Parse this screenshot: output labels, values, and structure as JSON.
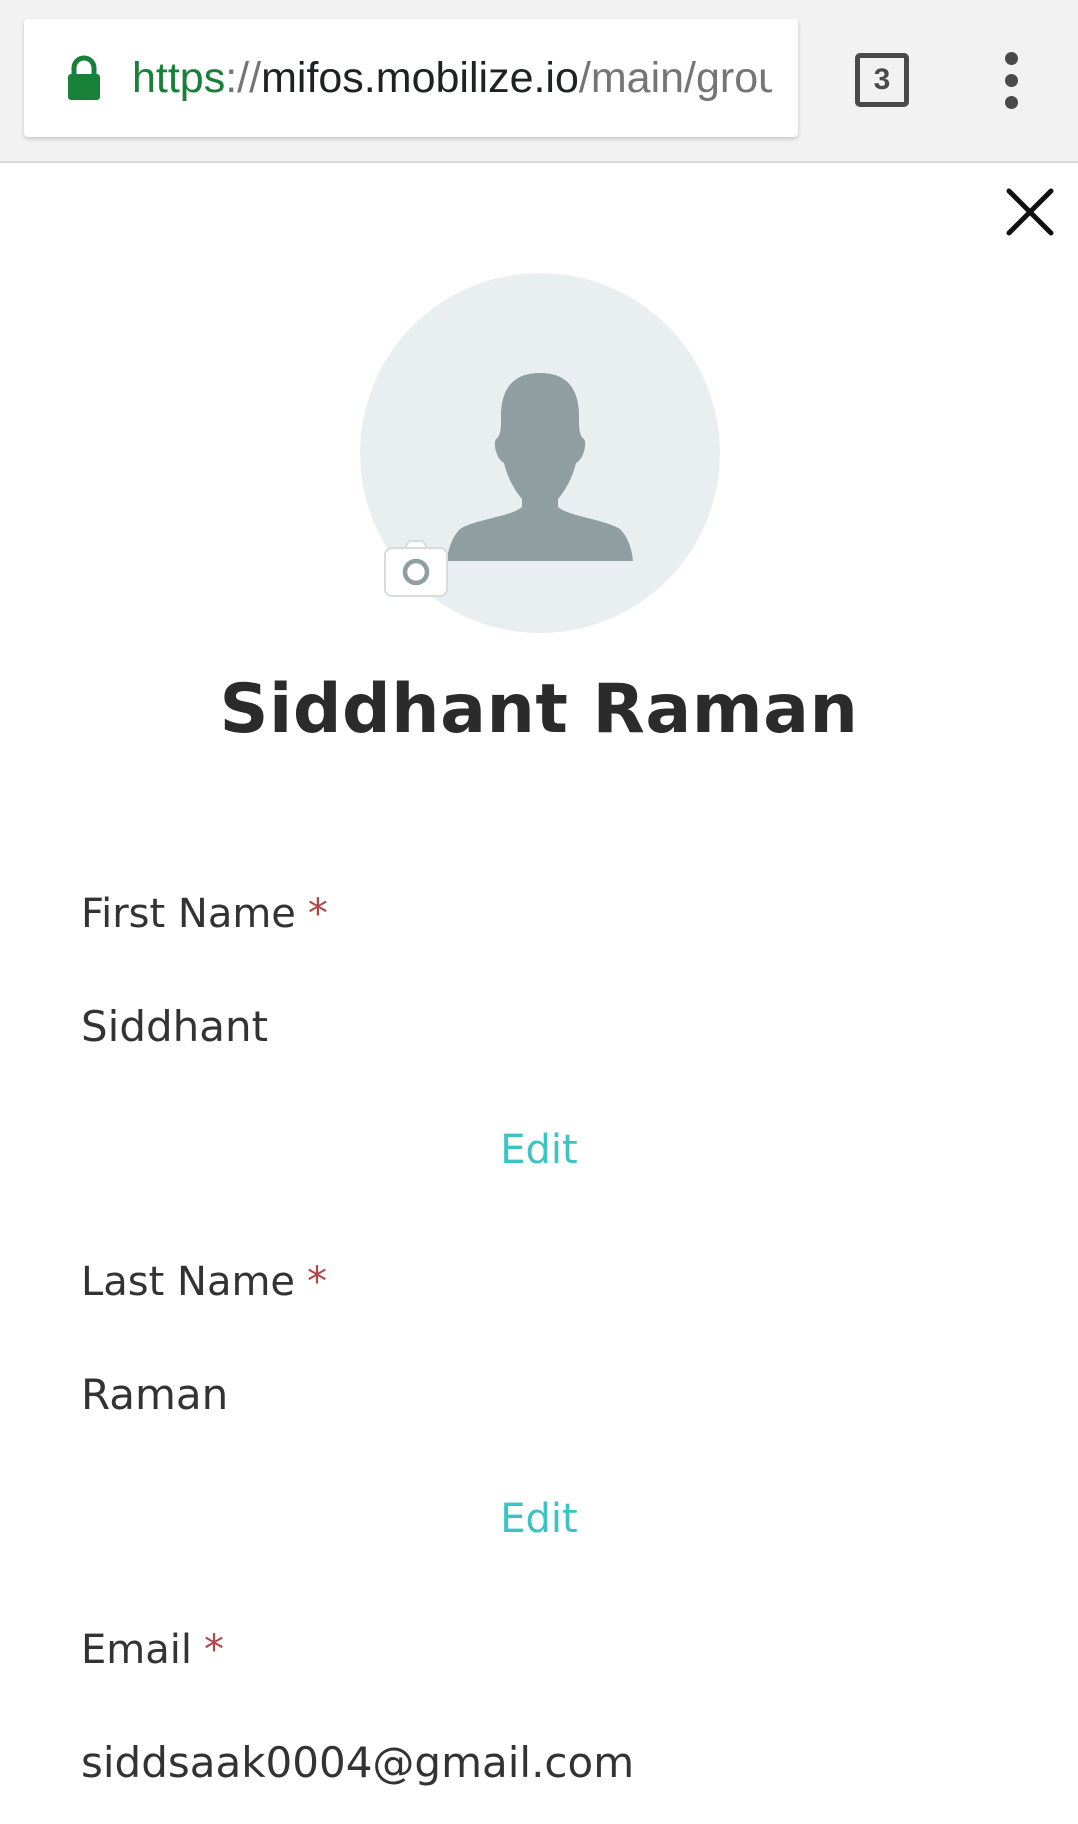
{
  "browser": {
    "url_scheme": "https",
    "url_separator": "://",
    "url_host": "mifos.mobilize.io",
    "url_path": "/main/grou",
    "tab_count": "3",
    "lock_icon": "lock-icon",
    "menu_icon": "more-vert-icon"
  },
  "colors": {
    "accent": "#3cc3c3",
    "required": "#b04848",
    "secure": "#188038"
  },
  "profile": {
    "name": "Siddhant Raman",
    "avatar_icon": "person-icon",
    "camera_icon": "camera-icon",
    "close_icon": "close-icon"
  },
  "fields": {
    "first_name": {
      "label": "First Name",
      "required_mark": "*",
      "value": "Siddhant",
      "edit_label": "Edit"
    },
    "last_name": {
      "label": "Last Name",
      "required_mark": "*",
      "value": "Raman",
      "edit_label": "Edit"
    },
    "email": {
      "label": "Email",
      "required_mark": "*",
      "value": "siddsaak0004@gmail.com"
    }
  }
}
